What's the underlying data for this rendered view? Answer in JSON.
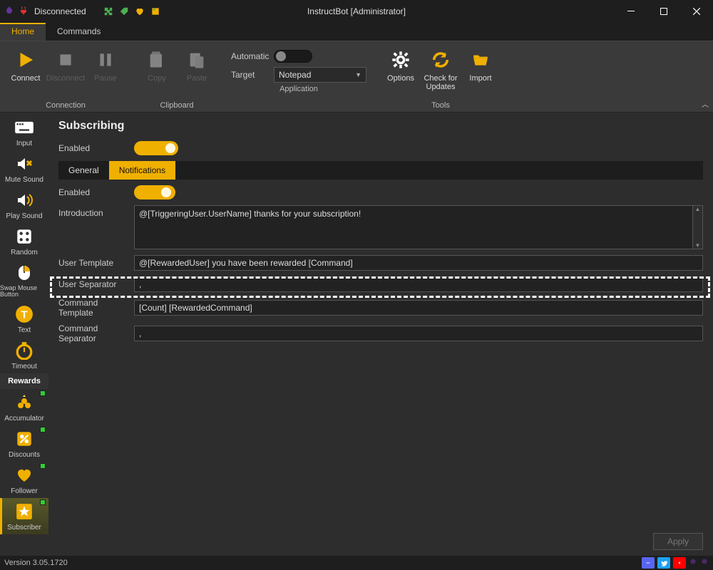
{
  "titlebar": {
    "status": "Disconnected",
    "title": "InstructBot [Administrator]"
  },
  "menu": {
    "home": "Home",
    "commands": "Commands"
  },
  "ribbon": {
    "connection": {
      "connect": "Connect",
      "disconnect": "Disconnect",
      "pause": "Pause",
      "label": "Connection"
    },
    "clipboard": {
      "copy": "Copy",
      "paste": "Paste",
      "label": "Clipboard"
    },
    "application": {
      "automatic": "Automatic",
      "target": "Target",
      "target_value": "Notepad",
      "label": "Application"
    },
    "tools": {
      "options": "Options",
      "check_updates": "Check for Updates",
      "import": "Import",
      "label": "Tools"
    }
  },
  "sidebar": {
    "input": "Input",
    "mute_sound": "Mute Sound",
    "play_sound": "Play Sound",
    "random": "Random",
    "swap_mouse": "Swap Mouse Button",
    "text": "Text",
    "timeout": "Timeout",
    "rewards": "Rewards",
    "accumulator": "Accumulator",
    "discounts": "Discounts",
    "follower": "Follower",
    "subscriber": "Subscriber"
  },
  "page": {
    "title": "Subscribing",
    "enabled": "Enabled",
    "tab_general": "General",
    "tab_notifications": "Notifications",
    "introduction_label": "Introduction",
    "introduction_value": "@[TriggeringUser.UserName] thanks for your subscription!",
    "user_template_label": "User Template",
    "user_template_value": "@[RewardedUser] you have been rewarded [Command]",
    "user_separator_label": "User Separator",
    "user_separator_value": ",",
    "command_template_label": "Command Template",
    "command_template_value": "[Count] [RewardedCommand]",
    "command_separator_label": "Command Separator",
    "command_separator_value": ",",
    "apply": "Apply"
  },
  "statusbar": {
    "version": "Version 3.05.1720"
  }
}
